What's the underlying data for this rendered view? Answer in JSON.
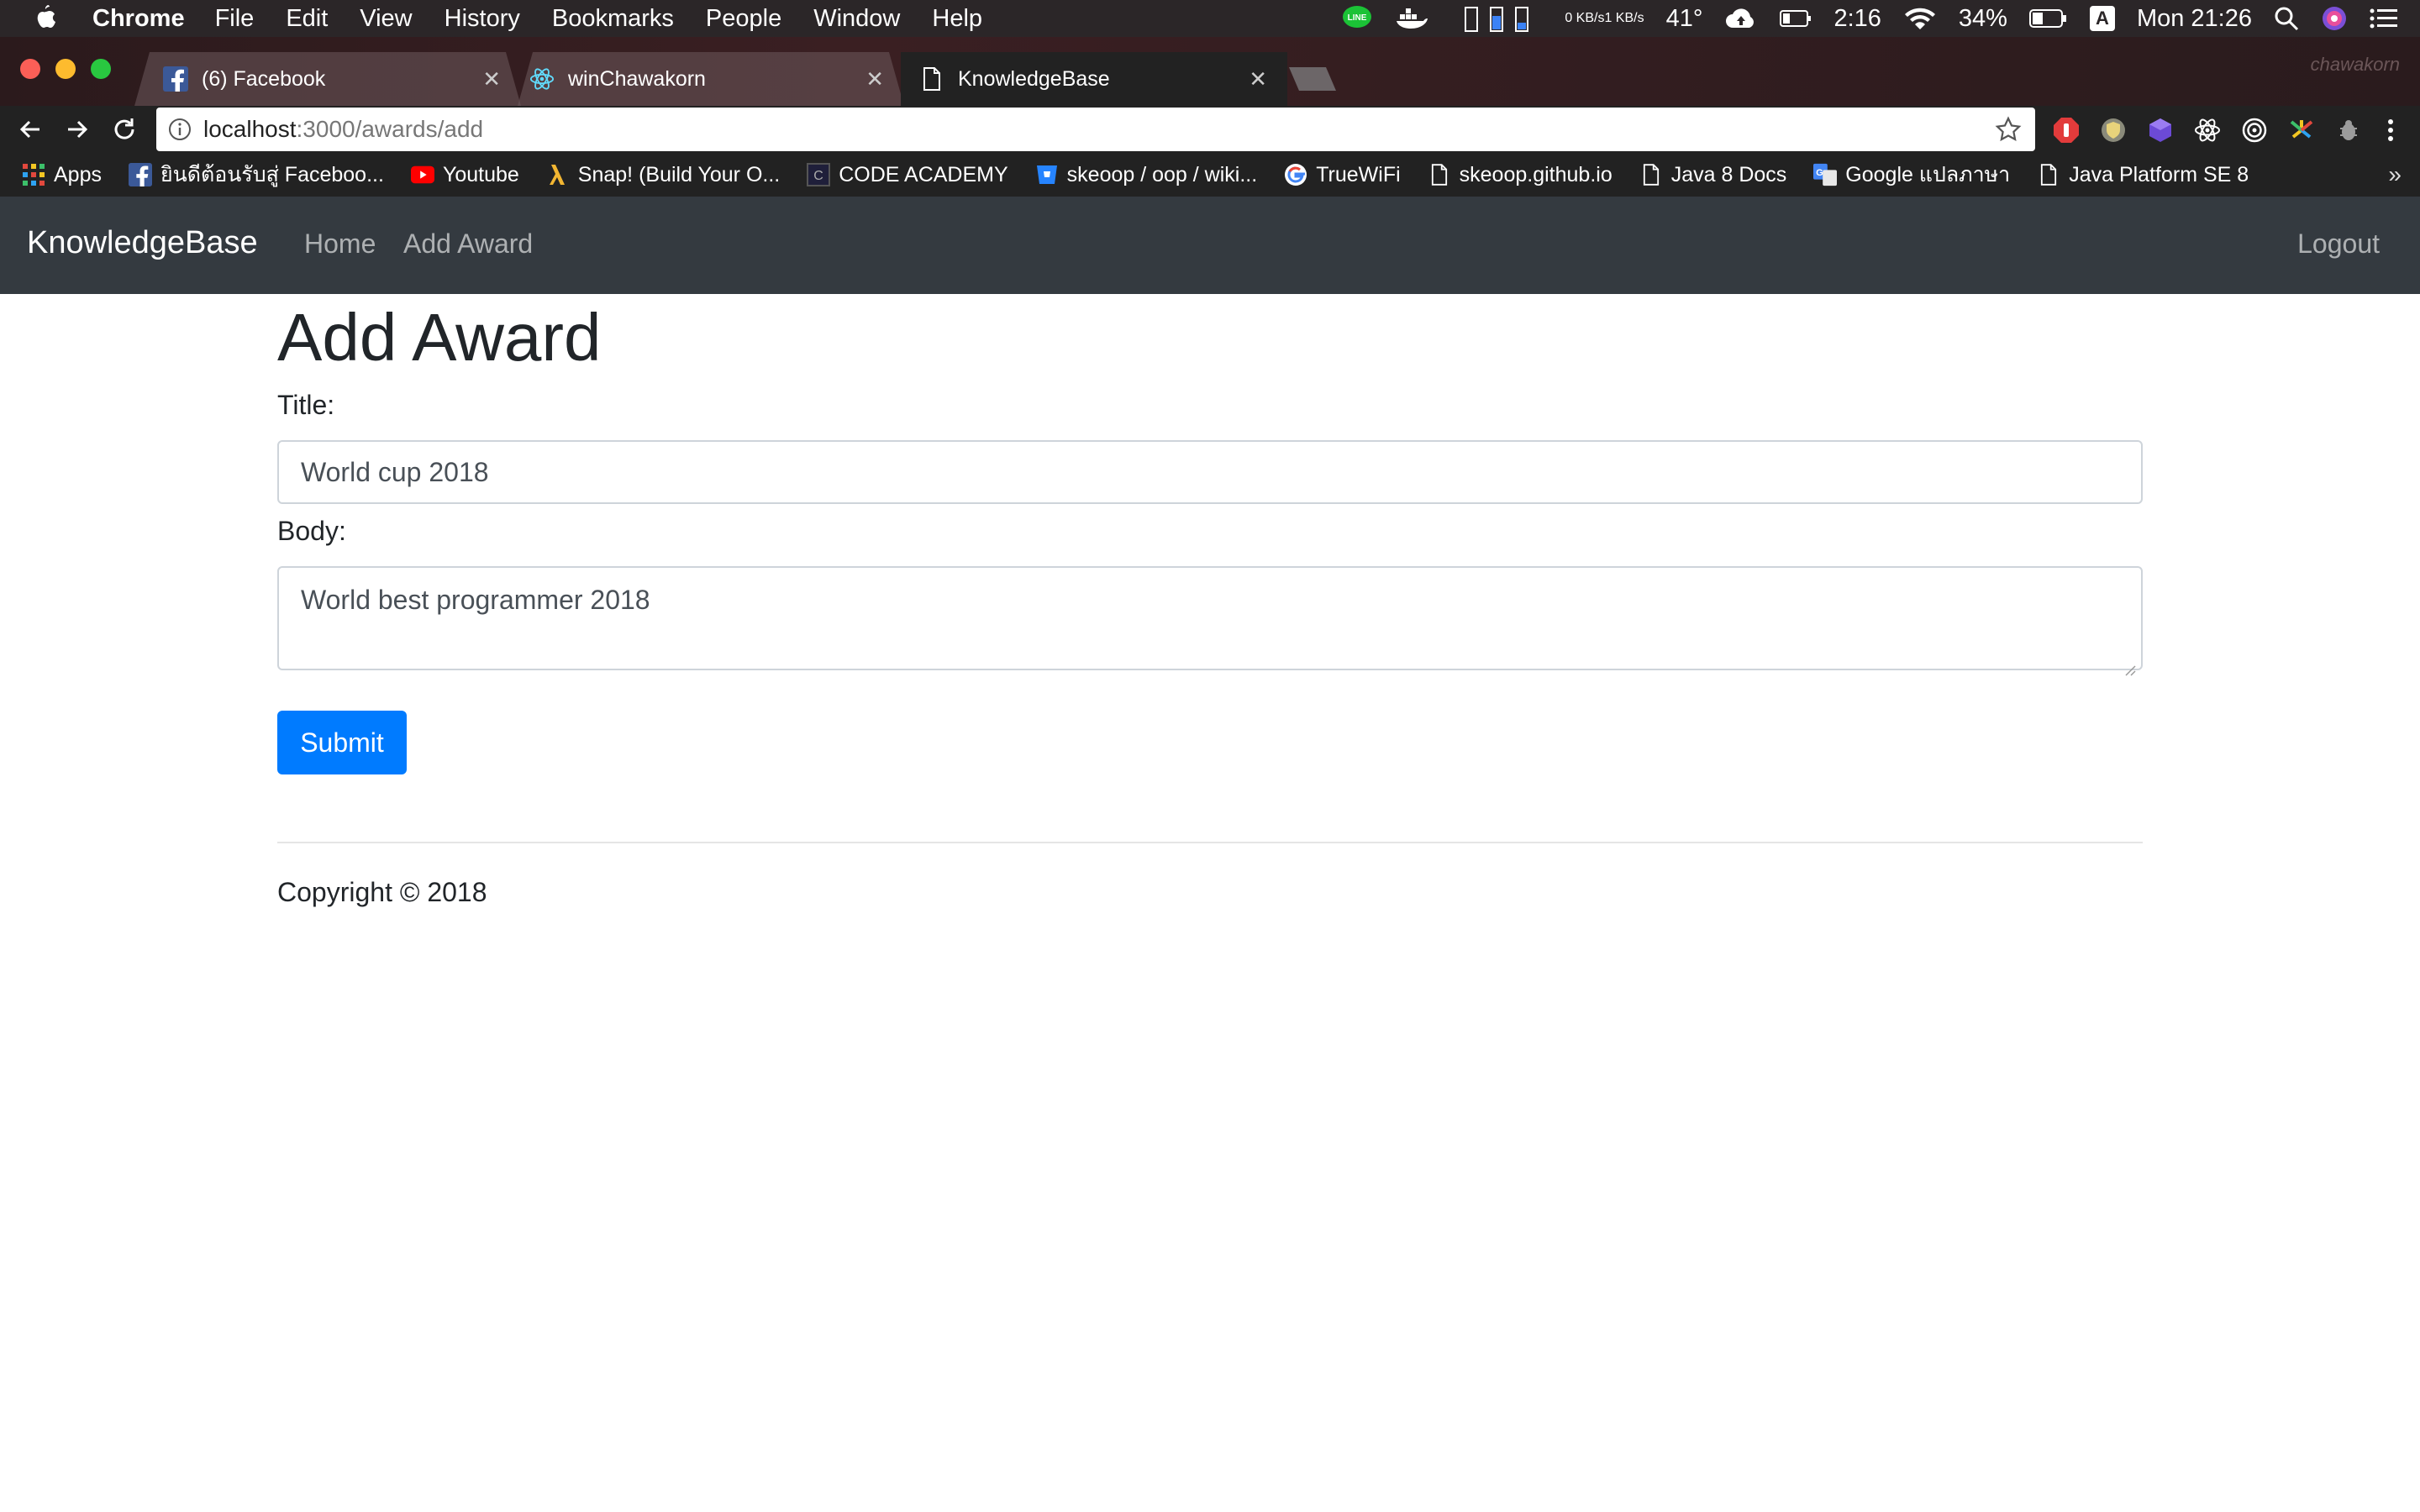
{
  "os_menubar": {
    "app_name": "Chrome",
    "menus": [
      "File",
      "Edit",
      "View",
      "History",
      "Bookmarks",
      "People",
      "Window",
      "Help"
    ],
    "net_up": "0 KB/s",
    "net_down": "1 KB/s",
    "temperature": "41°",
    "battery_time": "2:16",
    "battery_percent": "34%",
    "input_source": "A",
    "clock": "Mon 21:26"
  },
  "tabs": [
    {
      "title": "(6) Facebook",
      "icon": "facebook-icon"
    },
    {
      "title": "winChawakorn",
      "icon": "react-icon"
    },
    {
      "title": "KnowledgeBase",
      "icon": "document-icon",
      "active": true
    }
  ],
  "profile_name": "chawakorn",
  "omnibox": {
    "host": "localhost",
    "path": ":3000/awards/add"
  },
  "bookmarks": [
    {
      "label": "Apps",
      "icon": "apps-grid-icon"
    },
    {
      "label": "ยินดีต้อนรับสู่ Faceboo...",
      "icon": "facebook-icon"
    },
    {
      "label": "Youtube",
      "icon": "youtube-icon"
    },
    {
      "label": "Snap! (Build Your O...",
      "icon": "snap-lambda-icon"
    },
    {
      "label": "CODE ACADEMY",
      "icon": "codeacademy-icon"
    },
    {
      "label": "skeoop / oop / wiki...",
      "icon": "bitbucket-icon"
    },
    {
      "label": "TrueWiFi",
      "icon": "google-icon"
    },
    {
      "label": "skeoop.github.io",
      "icon": "document-icon"
    },
    {
      "label": "Java 8 Docs",
      "icon": "document-icon"
    },
    {
      "label": "Google แปลภาษา",
      "icon": "google-translate-icon"
    },
    {
      "label": "Java Platform SE 8",
      "icon": "document-icon"
    }
  ],
  "navbar": {
    "brand": "KnowledgeBase",
    "links": [
      "Home",
      "Add Award"
    ],
    "logout": "Logout"
  },
  "form": {
    "heading": "Add Award",
    "title_label": "Title:",
    "title_value": "World cup 2018",
    "body_label": "Body:",
    "body_value": "World best programmer 2018",
    "submit_label": "Submit"
  },
  "footer": {
    "copyright": "Copyright © 2018"
  },
  "colors": {
    "navbar_bg": "#343a40",
    "primary": "#007bff",
    "chrome_toolbar": "#222222"
  }
}
